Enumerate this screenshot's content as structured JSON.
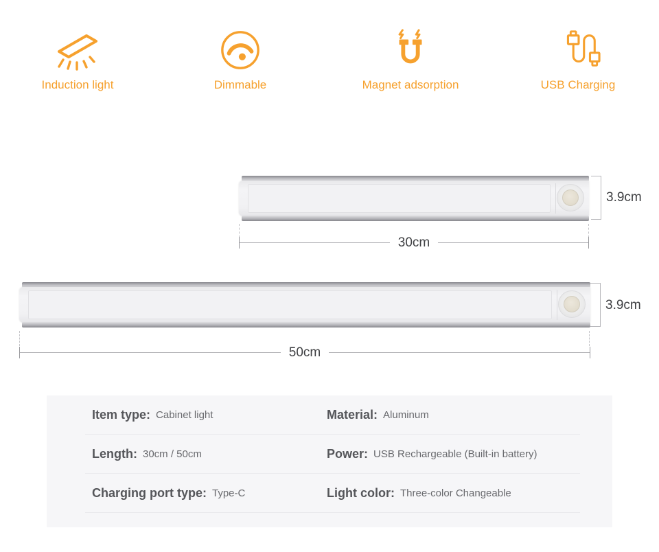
{
  "page": {
    "background": "#ffffff",
    "accent_color": "#F6A12E"
  },
  "features": {
    "items": [
      {
        "icon": "induction-light-icon",
        "label": "Induction light"
      },
      {
        "icon": "dimmable-icon",
        "label": "Dimmable"
      },
      {
        "icon": "magnet-adsorption-icon",
        "label": "Magnet adsorption"
      },
      {
        "icon": "usb-charging-icon",
        "label": "USB Charging"
      }
    ]
  },
  "diagrams": [
    {
      "product": "cabinet-light-short",
      "length_label": "30cm",
      "height_label": "3.9cm"
    },
    {
      "product": "cabinet-light-long",
      "length_label": "50cm",
      "height_label": "3.9cm"
    }
  ],
  "specs": {
    "rows": [
      {
        "left": {
          "label": "Item type:",
          "value": "Cabinet light"
        },
        "right": {
          "label": "Material:",
          "value": "Aluminum"
        }
      },
      {
        "left": {
          "label": "Length:",
          "value": "30cm / 50cm"
        },
        "right": {
          "label": "Power:",
          "value": "USB Rechargeable (Built-in battery)"
        }
      },
      {
        "left": {
          "label": "Charging port type:",
          "value": "Type-C"
        },
        "right": {
          "label": "Light color:",
          "value": "Three-color Changeable"
        }
      }
    ]
  }
}
